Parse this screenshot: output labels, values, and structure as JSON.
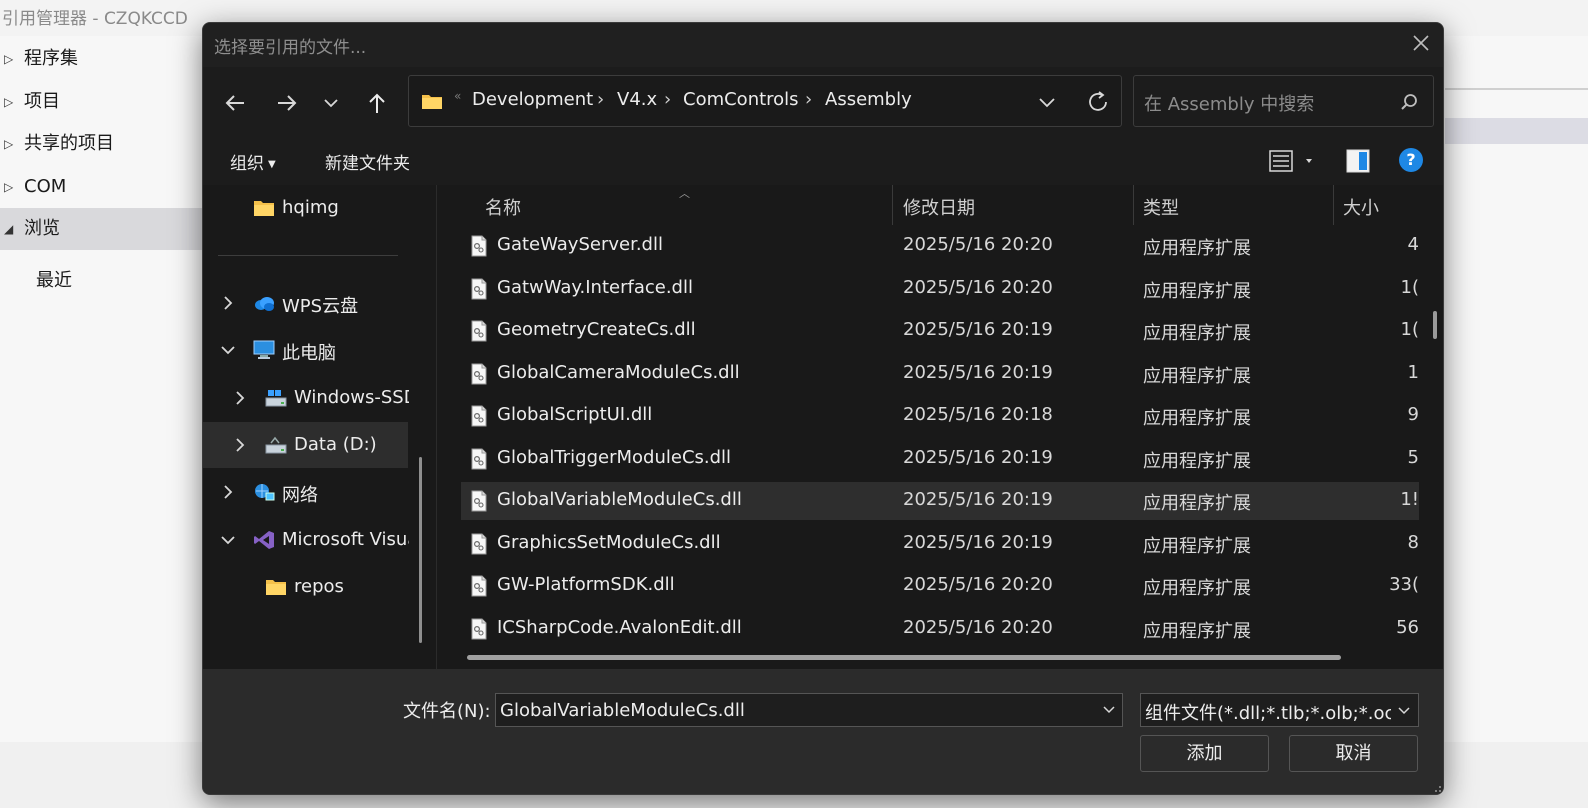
{
  "background": {
    "title": "引用管理器 - CZQKCCD",
    "nav": [
      {
        "label": "程序集",
        "expanded": false
      },
      {
        "label": "项目",
        "expanded": false
      },
      {
        "label": "共享的项目",
        "expanded": false
      },
      {
        "label": "COM",
        "expanded": false
      },
      {
        "label": "浏览",
        "expanded": true
      }
    ],
    "sub_item": "最近"
  },
  "dialog": {
    "title": "选择要引用的文件...",
    "address": {
      "overflow": "«",
      "crumbs": [
        "Development",
        "V4.x",
        "ComControls",
        "Assembly"
      ]
    },
    "search": {
      "placeholder": "在 Assembly 中搜索"
    },
    "toolbar": {
      "organize": "组织",
      "new_folder": "新建文件夹",
      "help": "?"
    },
    "nav_pane": [
      {
        "label": "hqimg",
        "icon": "folder-icon"
      },
      {
        "label": "WPS云盘",
        "icon": "cloud-icon"
      },
      {
        "label": "此电脑",
        "icon": "computer-icon"
      },
      {
        "label": "Windows-SSD",
        "icon": "drive-icon"
      },
      {
        "label": "Data (D:)",
        "icon": "drive-icon",
        "selected": true
      },
      {
        "label": "网络",
        "icon": "network-icon"
      },
      {
        "label": "Microsoft Visual Studio",
        "icon": "visual-studio-icon"
      },
      {
        "label": "repos",
        "icon": "folder-icon"
      }
    ],
    "columns": {
      "name": "名称",
      "date": "修改日期",
      "type": "类型",
      "size": "大小"
    },
    "files": [
      {
        "name": "GateWayServer.dll",
        "date": "2025/5/16 20:20",
        "type": "应用程序扩展",
        "size": "4"
      },
      {
        "name": "GatwWay.Interface.dll",
        "date": "2025/5/16 20:20",
        "type": "应用程序扩展",
        "size": "1("
      },
      {
        "name": "GeometryCreateCs.dll",
        "date": "2025/5/16 20:19",
        "type": "应用程序扩展",
        "size": "1("
      },
      {
        "name": "GlobalCameraModuleCs.dll",
        "date": "2025/5/16 20:19",
        "type": "应用程序扩展",
        "size": "1"
      },
      {
        "name": "GlobalScriptUI.dll",
        "date": "2025/5/16 20:18",
        "type": "应用程序扩展",
        "size": "9"
      },
      {
        "name": "GlobalTriggerModuleCs.dll",
        "date": "2025/5/16 20:19",
        "type": "应用程序扩展",
        "size": "5"
      },
      {
        "name": "GlobalVariableModuleCs.dll",
        "date": "2025/5/16 20:19",
        "type": "应用程序扩展",
        "size": "1!",
        "selected": true
      },
      {
        "name": "GraphicsSetModuleCs.dll",
        "date": "2025/5/16 20:19",
        "type": "应用程序扩展",
        "size": "8"
      },
      {
        "name": "GW-PlatformSDK.dll",
        "date": "2025/5/16 20:20",
        "type": "应用程序扩展",
        "size": "33("
      },
      {
        "name": "ICSharpCode.AvalonEdit.dll",
        "date": "2025/5/16 20:20",
        "type": "应用程序扩展",
        "size": "56"
      }
    ],
    "footer": {
      "filename_label": "文件名(N):",
      "filename_value": "GlobalVariableModuleCs.dll",
      "filetype_value": "组件文件(*.dll;*.tlb;*.olb;*.ocx;*",
      "add_button": "添加",
      "cancel_button": "取消"
    }
  },
  "colors": {
    "dialog_bg": "#202020",
    "accent": "#1e88e5",
    "folder": "#f4c04a"
  }
}
